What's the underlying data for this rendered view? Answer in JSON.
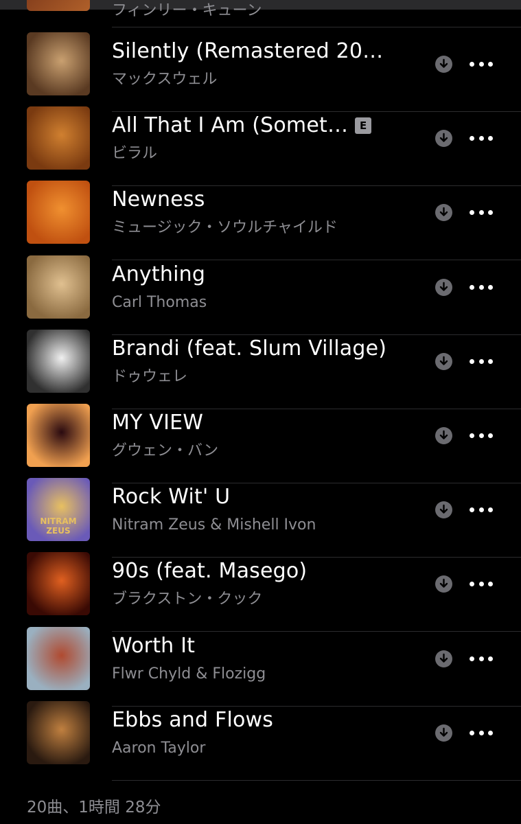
{
  "previous_row": {
    "artist": "フィンリー・キューン"
  },
  "songs": [
    {
      "title": "Silently (Remastered 20…",
      "artist": "マックスウェル",
      "explicit": false,
      "art_colors": [
        "#5a3a22",
        "#c9a070"
      ]
    },
    {
      "title": "All That I Am (Somet…",
      "artist": "ビラル",
      "explicit": true,
      "explicit_label": "E",
      "art_colors": [
        "#7a3a10",
        "#d08030"
      ]
    },
    {
      "title": "Newness",
      "artist": "ミュージック・ソウルチャイルド",
      "explicit": false,
      "art_colors": [
        "#c05010",
        "#f09030"
      ]
    },
    {
      "title": "Anything",
      "artist": "Carl Thomas",
      "explicit": false,
      "art_colors": [
        "#8a6a40",
        "#e0c090"
      ]
    },
    {
      "title": "Brandi (feat. Slum Village)",
      "artist": "ドゥウェレ",
      "explicit": false,
      "art_colors": [
        "#303030",
        "#f0f0f0"
      ]
    },
    {
      "title": "MY VIEW",
      "artist": "グウェン・バン",
      "explicit": false,
      "art_colors": [
        "#f0a050",
        "#2a0a10"
      ]
    },
    {
      "title": "Rock Wit' U",
      "artist": "Nitram Zeus & Mishell Ivon",
      "explicit": false,
      "art_colors": [
        "#6a5ab8",
        "#e8c060"
      ],
      "art_text": "NITRAM ZEUS"
    },
    {
      "title": "90s (feat. Masego)",
      "artist": "ブラクストン・クック",
      "explicit": false,
      "art_colors": [
        "#3a0a04",
        "#e06020"
      ]
    },
    {
      "title": "Worth It",
      "artist": "Flwr Chyld & Flozigg",
      "explicit": false,
      "art_colors": [
        "#9ab0c0",
        "#b04a30"
      ]
    },
    {
      "title": "Ebbs and Flows",
      "artist": "Aaron Taylor",
      "explicit": false,
      "art_colors": [
        "#2a1a10",
        "#c08040"
      ]
    }
  ],
  "footer": {
    "summary": "20曲、1時間 28分"
  },
  "icons": {
    "download": "download-circle-icon",
    "more": "more-ellipsis-icon"
  }
}
